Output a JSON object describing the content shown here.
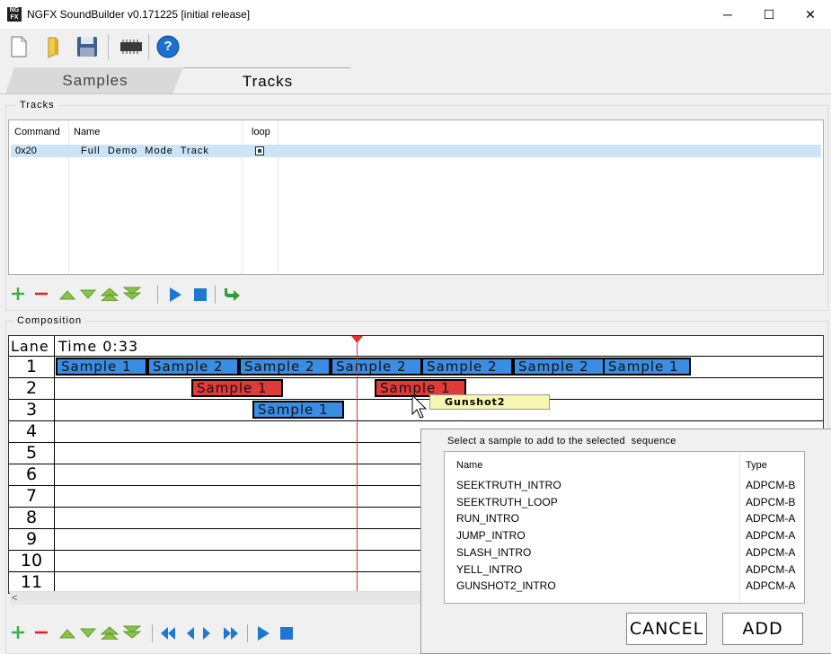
{
  "window": {
    "title": "NGFX SoundBuilder v0.171225 [initial release]",
    "icon_text": "NG FX",
    "minimize": "─",
    "maximize": "☐",
    "close": "✕"
  },
  "toolbar": {
    "items": [
      "new-file-icon",
      "open-folder-icon",
      "save-icon",
      "chip-icon",
      "help-icon"
    ],
    "help_glyph": "?"
  },
  "tabs": [
    {
      "label": "Samples",
      "active": false
    },
    {
      "label": "Tracks",
      "active": true
    }
  ],
  "tracks": {
    "group_label": "Tracks",
    "columns": [
      "Command",
      "Name",
      "loop"
    ],
    "rows": [
      {
        "command": "0x20",
        "name": "Full  Demo  Mode  Track",
        "loop": true
      }
    ]
  },
  "composition": {
    "group_label": "Composition",
    "lane_header": "Lane",
    "time_label": "Time 0:33",
    "lanes": [
      "1",
      "2",
      "3",
      "4",
      "5",
      "6",
      "7",
      "8",
      "9",
      "10",
      "11"
    ],
    "blocks": [
      {
        "lane": 1,
        "label": "Sample 1",
        "color": "blue"
      },
      {
        "lane": 1,
        "label": "Sample 2",
        "color": "blue"
      },
      {
        "lane": 1,
        "label": "Sample 2",
        "color": "blue"
      },
      {
        "lane": 1,
        "label": "Sample 2",
        "color": "blue"
      },
      {
        "lane": 1,
        "label": "Sample 2",
        "color": "blue"
      },
      {
        "lane": 1,
        "label": "Sample 2",
        "color": "blue"
      },
      {
        "lane": 1,
        "label": "Sample 1",
        "color": "blue"
      },
      {
        "lane": 2,
        "label": "Sample 1",
        "color": "red"
      },
      {
        "lane": 2,
        "label": "Sample 1",
        "color": "red"
      },
      {
        "lane": 3,
        "label": "Sample 1",
        "color": "blue"
      }
    ],
    "drag_tooltip": "Gunshot2",
    "scroll_left": "<"
  },
  "dialog": {
    "prompt": "Select a sample to add to the selected  sequence",
    "columns": [
      "Name",
      "Type"
    ],
    "samples": [
      {
        "name": "SEEKTRUTH_INTRO",
        "type": "ADPCM-B"
      },
      {
        "name": "SEEKTRUTH_LOOP",
        "type": "ADPCM-B"
      },
      {
        "name": "RUN_INTRO",
        "type": "ADPCM-A"
      },
      {
        "name": "JUMP_INTRO",
        "type": "ADPCM-A"
      },
      {
        "name": "SLASH_INTRO",
        "type": "ADPCM-A"
      },
      {
        "name": "YELL_INTRO",
        "type": "ADPCM-A"
      },
      {
        "name": "GUNSHOT2_INTRO",
        "type": "ADPCM-A"
      }
    ],
    "cancel_label": "CANCEL",
    "add_label": "ADD"
  },
  "colors": {
    "blue_block": "#3a8de3",
    "red_block": "#e03a3a",
    "selection": "#cce4f7",
    "green_icon": "#3cb043",
    "red_icon": "#e02020",
    "blue_icon": "#1e78d2"
  }
}
